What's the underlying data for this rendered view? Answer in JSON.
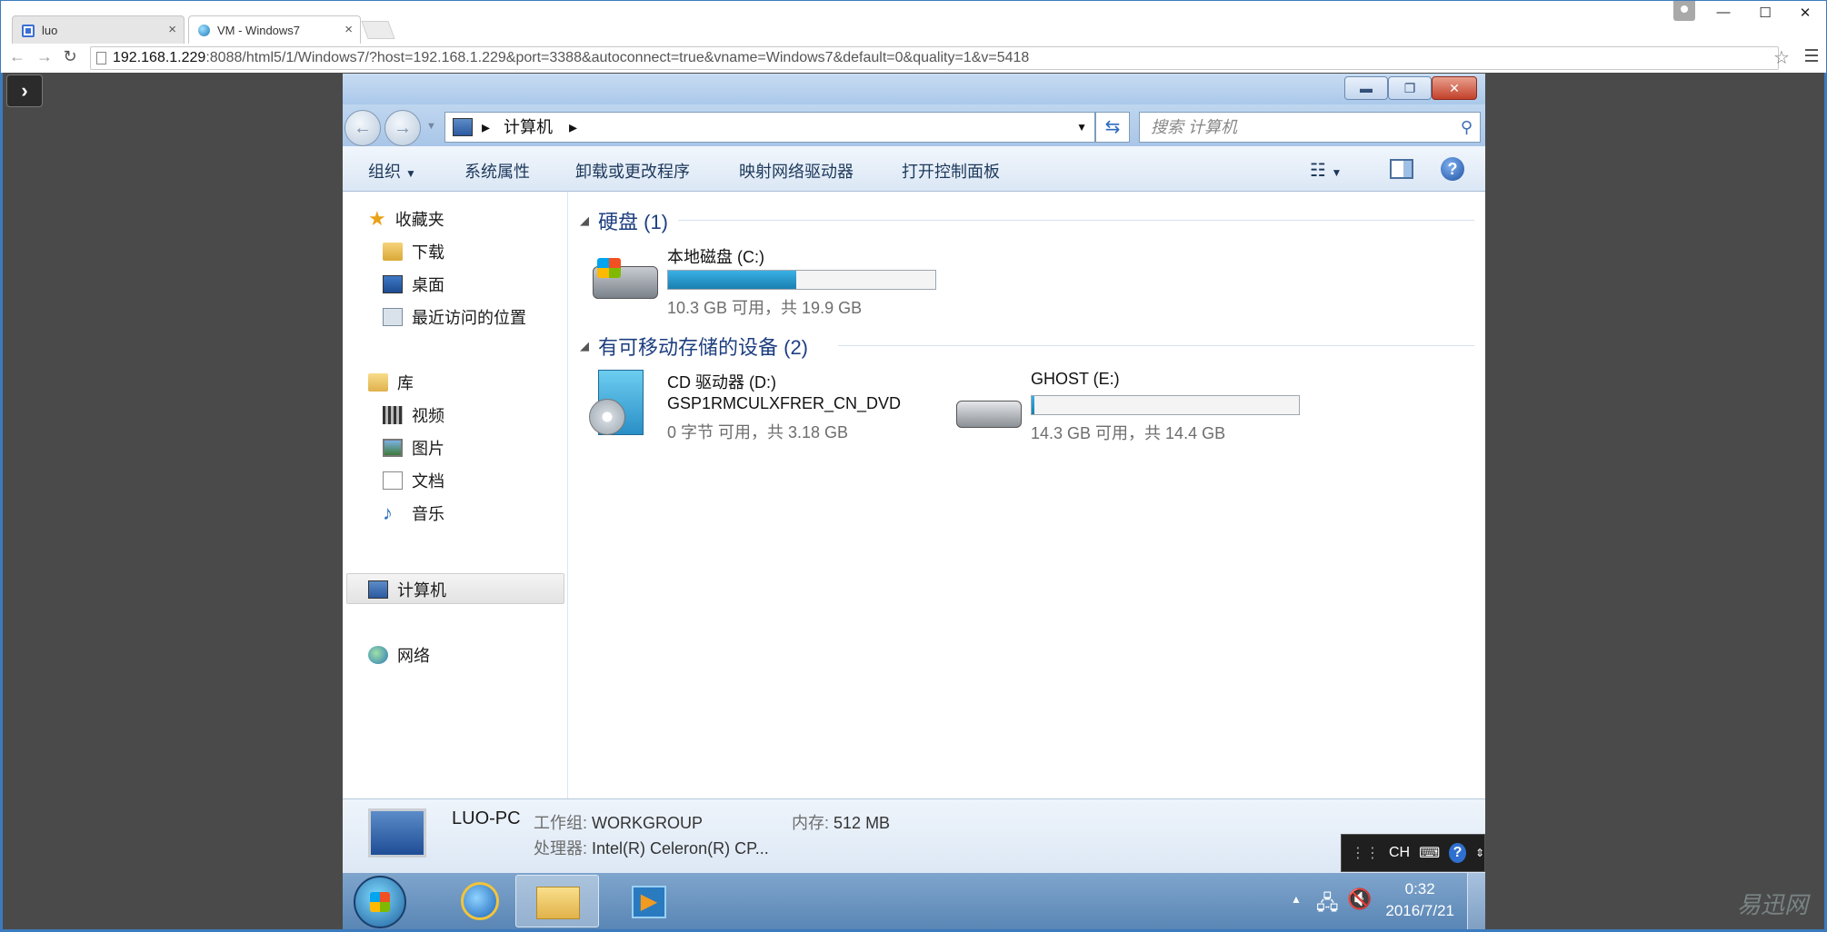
{
  "browser": {
    "tabs": [
      {
        "label": "luo"
      },
      {
        "label": "VM - Windows7"
      }
    ],
    "url_host": "192.168.1.229",
    "url_rest": ":8088/html5/1/Windows7/?host=192.168.1.229&port=3388&autoconnect=true&vname=Windows7&default=0&quality=1&v=5418"
  },
  "explorer": {
    "address_crumb": "计算机",
    "search_placeholder": "搜索 计算机",
    "commands": [
      "组织",
      "系统属性",
      "卸载或更改程序",
      "映射网络驱动器",
      "打开控制面板"
    ],
    "nav": {
      "favorites": "收藏夹",
      "downloads": "下载",
      "desktop": "桌面",
      "recent": "最近访问的位置",
      "libraries": "库",
      "videos": "视频",
      "pictures": "图片",
      "documents": "文档",
      "music": "音乐",
      "computer": "计算机",
      "network": "网络"
    },
    "groups": [
      {
        "title": "硬盘 (1)"
      },
      {
        "title": "有可移动存储的设备 (2)"
      }
    ],
    "drives": [
      {
        "name": "本地磁盘 (C:)",
        "info": "10.3 GB 可用，共 19.9 GB",
        "used_fraction": 0.48
      },
      {
        "name": "CD 驱动器 (D:)",
        "label": "GSP1RMCULXFRER_CN_DVD",
        "info": "0 字节 可用，共 3.18 GB"
      },
      {
        "name": "GHOST (E:)",
        "info": "14.3 GB 可用，共 14.4 GB",
        "used_fraction": 0.01
      }
    ],
    "details": {
      "pc_name": "LUO-PC",
      "workgroup_label": "工作组:",
      "workgroup": "WORKGROUP",
      "memory_label": "内存:",
      "memory": "512 MB",
      "cpu_label": "处理器:",
      "cpu": "Intel(R) Celeron(R) CP..."
    }
  },
  "langbar": {
    "text": "CH"
  },
  "taskbar": {
    "time": "0:32",
    "date": "2016/7/21"
  },
  "watermark": "易迅网",
  "colors": {
    "window_frame": "#3b7bbf",
    "remote_bg": "#4a4a4a",
    "group_header": "#1e3f80",
    "progress": "#26a0da"
  }
}
